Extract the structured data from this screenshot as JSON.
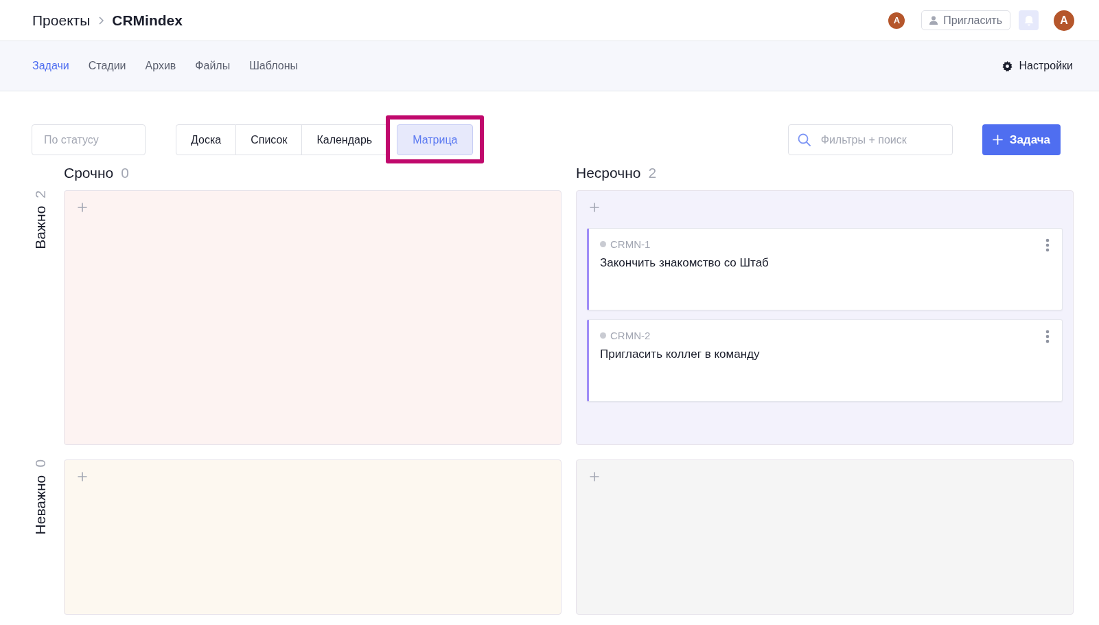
{
  "breadcrumb": {
    "parent": "Проекты",
    "current": "CRMindex"
  },
  "header": {
    "member_avatar": "A",
    "invite": "Пригласить",
    "user_avatar": "A"
  },
  "nav": {
    "tabs": [
      {
        "label": "Задачи",
        "selected": true
      },
      {
        "label": "Стадии",
        "selected": false
      },
      {
        "label": "Архив",
        "selected": false
      },
      {
        "label": "Файлы",
        "selected": false
      },
      {
        "label": "Шаблоны",
        "selected": false
      }
    ],
    "settings": "Настройки"
  },
  "toolbar": {
    "status_filter": {
      "placeholder": "По статусу"
    },
    "views": [
      {
        "label": "Доска",
        "selected": false,
        "highlighted": false
      },
      {
        "label": "Список",
        "selected": false,
        "highlighted": false
      },
      {
        "label": "Календарь",
        "selected": false,
        "highlighted": false
      },
      {
        "label": "Матрица",
        "selected": true,
        "highlighted": true
      }
    ],
    "search": {
      "placeholder": "Фильтры + поиск"
    },
    "add_button": "Задача"
  },
  "matrix": {
    "columns": [
      {
        "title": "Срочно",
        "count": "0"
      },
      {
        "title": "Несрочно",
        "count": "2"
      }
    ],
    "rows": [
      {
        "title": "Важно",
        "count": "2",
        "cells": [
          {
            "color": "#fdf3f2"
          },
          {
            "color": "#f3f2fc",
            "tasks": [
              {
                "key": "CRMN-1",
                "title": "Закончить знакомство со Штаб"
              },
              {
                "key": "CRMN-2",
                "title": "Пригласить коллег в команду"
              }
            ]
          }
        ]
      },
      {
        "title": "Неважно",
        "count": "0",
        "cells": [
          {
            "color": "#fdf8f0"
          },
          {
            "color": "#f5f5f5"
          }
        ]
      }
    ]
  }
}
